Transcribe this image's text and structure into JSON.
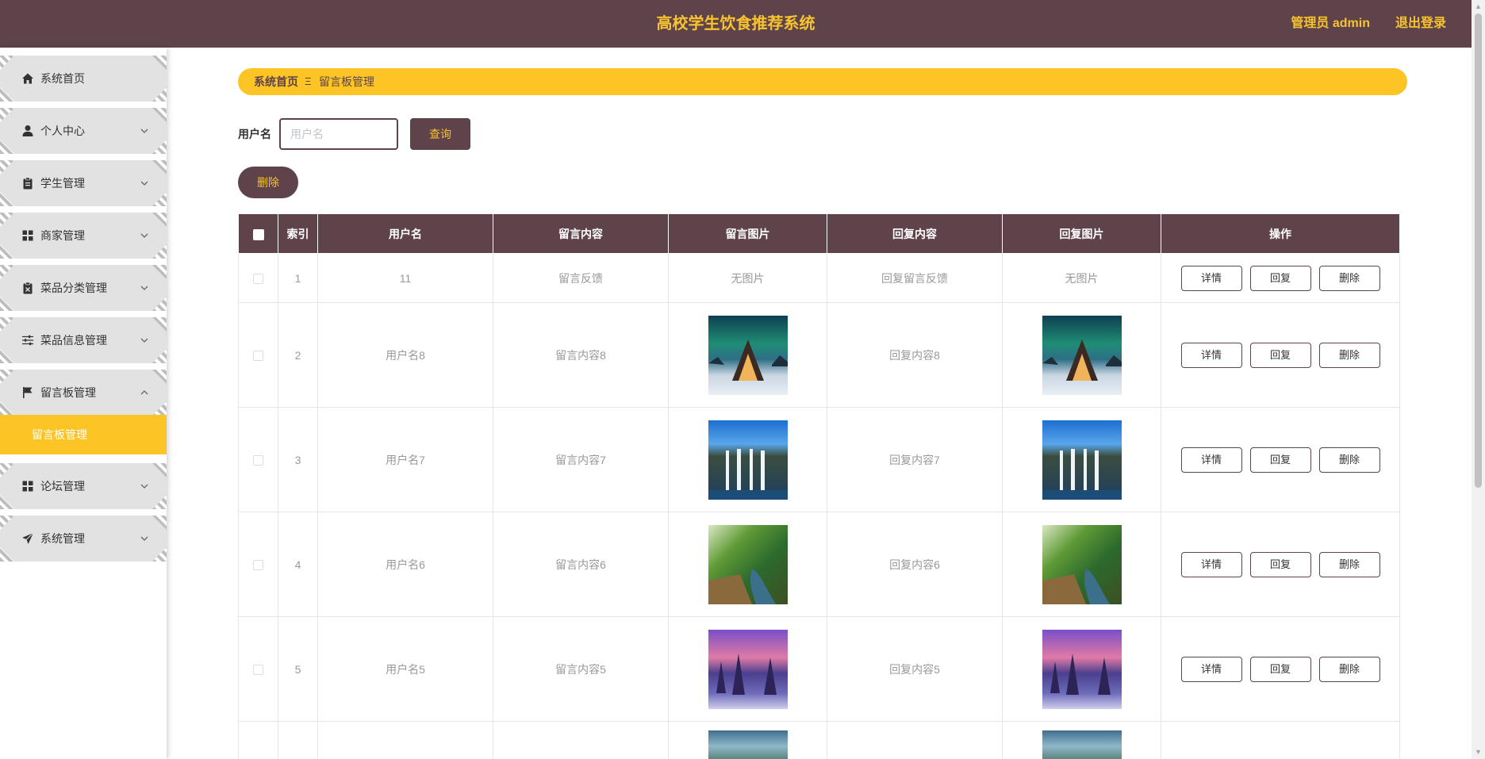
{
  "header": {
    "title": "高校学生饮食推荐系统",
    "user": "管理员 admin",
    "logout": "退出登录"
  },
  "sidebar": {
    "items": [
      {
        "label": "系统首页",
        "icon": "home-icon"
      },
      {
        "label": "个人中心",
        "icon": "user-icon"
      },
      {
        "label": "学生管理",
        "icon": "clipboard-icon"
      },
      {
        "label": "商家管理",
        "icon": "grid-icon"
      },
      {
        "label": "菜品分类管理",
        "icon": "clipboard-x-icon"
      },
      {
        "label": "菜品信息管理",
        "icon": "sliders-icon"
      },
      {
        "label": "留言板管理",
        "icon": "flag-icon"
      },
      {
        "label": "论坛管理",
        "icon": "grid-icon"
      },
      {
        "label": "系统管理",
        "icon": "send-icon"
      }
    ],
    "active_sub": "留言板管理"
  },
  "breadcrumb": {
    "home": "系统首页",
    "separator": "Ξ",
    "current": "留言板管理"
  },
  "search": {
    "label": "用户名",
    "placeholder": "用户名",
    "value": "",
    "query_label": "查询"
  },
  "delete_label": "删除",
  "table": {
    "headers": [
      "",
      "索引",
      "用户名",
      "留言内容",
      "留言图片",
      "回复内容",
      "回复图片",
      "操作"
    ],
    "actions": [
      "详情",
      "回复",
      "删除"
    ],
    "no_image_text": "无图片",
    "rows": [
      {
        "index": "1",
        "username": "11",
        "content": "留言反馈",
        "image": "none",
        "reply": "回复留言反馈",
        "reply_image": "none"
      },
      {
        "index": "2",
        "username": "用户名8",
        "content": "留言内容8",
        "image": "aurora-cabin-photo",
        "reply": "回复内容8",
        "reply_image": "aurora-cabin-photo"
      },
      {
        "index": "3",
        "username": "用户名7",
        "content": "留言内容7",
        "image": "waterfall-photo",
        "reply": "回复内容7",
        "reply_image": "waterfall-photo"
      },
      {
        "index": "4",
        "username": "用户名6",
        "content": "留言内容6",
        "image": "forest-river-photo",
        "reply": "回复内容6",
        "reply_image": "forest-river-photo"
      },
      {
        "index": "5",
        "username": "用户名5",
        "content": "留言内容5",
        "image": "snowy-forest-photo",
        "reply": "回复内容5",
        "reply_image": "snowy-forest-photo"
      }
    ]
  },
  "colors": {
    "primary": "#5e434b",
    "accent": "#fcc425",
    "accent_text": "#f7c32e"
  }
}
